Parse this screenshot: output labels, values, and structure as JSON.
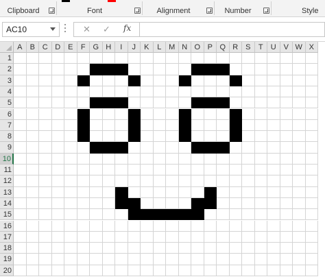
{
  "ribbon": {
    "groups": [
      {
        "label": "Clipboard"
      },
      {
        "label": "Font"
      },
      {
        "label": "Alignment"
      },
      {
        "label": "Number"
      },
      {
        "label": "Style"
      }
    ],
    "font_color_swatch": "#ff0000"
  },
  "formula_bar": {
    "name_box": "AC10",
    "cancel_glyph": "✕",
    "enter_glyph": "✓",
    "fx_label": "fx",
    "formula": ""
  },
  "sheet": {
    "columns": [
      "A",
      "B",
      "C",
      "D",
      "E",
      "F",
      "G",
      "H",
      "I",
      "J",
      "K",
      "L",
      "M",
      "N",
      "O",
      "P",
      "Q",
      "R",
      "S",
      "T",
      "U",
      "V",
      "W",
      "X"
    ],
    "rows": [
      "1",
      "2",
      "3",
      "4",
      "5",
      "6",
      "7",
      "8",
      "9",
      "10",
      "11",
      "12",
      "13",
      "14",
      "15",
      "16",
      "17",
      "18",
      "19",
      "20"
    ],
    "active_row": "10",
    "fill_color": "#000000",
    "filled_cells": [
      "G2",
      "H2",
      "I2",
      "O2",
      "P2",
      "Q2",
      "F3",
      "J3",
      "N3",
      "R3",
      "G5",
      "H5",
      "I5",
      "O5",
      "P5",
      "Q5",
      "F6",
      "J6",
      "N6",
      "R6",
      "F7",
      "J7",
      "N7",
      "R7",
      "F8",
      "J8",
      "N8",
      "R8",
      "G9",
      "H9",
      "I9",
      "O9",
      "P9",
      "Q9",
      "I13",
      "P13",
      "I14",
      "J14",
      "O14",
      "P14",
      "J15",
      "K15",
      "L15",
      "M15",
      "N15",
      "O15"
    ]
  }
}
